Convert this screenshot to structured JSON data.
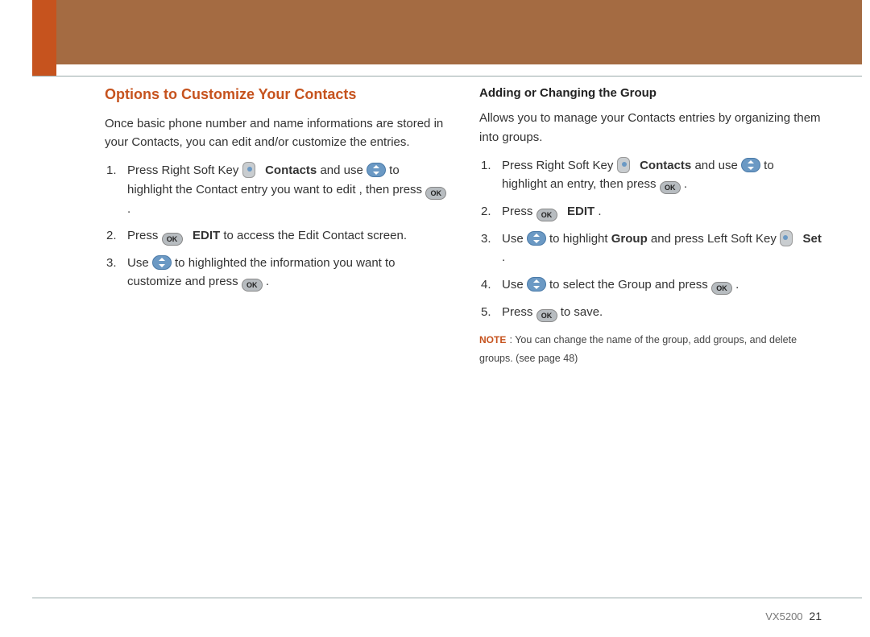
{
  "left": {
    "title": "Options to Customize Your Contacts",
    "intro": "Once basic phone number and name informations are stored in your Contacts, you can edit and/or customize the entries.",
    "step1_a": "Press Right Soft Key ",
    "step1_contacts": "Contacts",
    "step1_b": " and use ",
    "step1_c": " to highlight the Contact entry you want to edit , then press ",
    "step1_d": " .",
    "step2_a": "Press ",
    "step2_edit": "EDIT",
    "step2_b": " to access the Edit Contact screen.",
    "step3_a": "Use ",
    "step3_b": " to highlighted the information you want to customize and press ",
    "step3_c": " ."
  },
  "right": {
    "title": "Adding or Changing the Group",
    "intro": "Allows you to manage your Contacts entries by organizing them into groups.",
    "step1_a": "Press Right Soft Key ",
    "step1_contacts": "Contacts",
    "step1_b": " and use ",
    "step1_c": " to highlight an entry, then press ",
    "step1_d": " .",
    "step2_a": "Press ",
    "step2_edit": "EDIT",
    "step2_b": ".",
    "step3_a": "Use ",
    "step3_b": " to highlight ",
    "step3_group": "Group",
    "step3_c": " and press Left Soft Key ",
    "step3_set": "Set",
    "step3_d": ".",
    "step4_a": "Use ",
    "step4_b": " to select the Group and press ",
    "step4_c": " .",
    "step5_a": "Press ",
    "step5_b": " to save.",
    "note_label": "NOTE",
    "note_body": " : You can change the name of the group, add groups, and delete groups. (see page 48)"
  },
  "icons": {
    "ok": "OK"
  },
  "footer": {
    "model": "VX5200",
    "page": "21"
  }
}
